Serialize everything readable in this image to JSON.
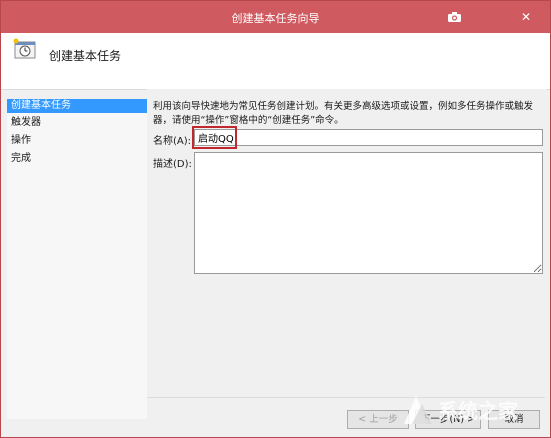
{
  "window": {
    "title": "创建基本任务向导",
    "close_label": "✕"
  },
  "header": {
    "title": "创建基本任务"
  },
  "nav": {
    "items": [
      {
        "label": "创建基本任务",
        "active": true
      },
      {
        "label": "触发器",
        "active": false
      },
      {
        "label": "操作",
        "active": false
      },
      {
        "label": "完成",
        "active": false
      }
    ]
  },
  "form": {
    "description_line1": "利用该向导快速地为常见任务创建计划。有关更多高级选项或设置，例如多任务操作或触发",
    "description_line2": "器，请使用“操作”窗格中的“创建任务”命令。",
    "name_label": "名称(A):",
    "name_value": "启动QQ",
    "desc_label": "描述(D):",
    "desc_value": ""
  },
  "buttons": {
    "back": "< 上一步",
    "next": "下一步(N) >",
    "cancel": "取消"
  },
  "watermark": {
    "text": "系统之家"
  },
  "colors": {
    "titlebar": "#cf5a5f",
    "selection": "#3399ff",
    "highlight_border": "#c0282d"
  }
}
